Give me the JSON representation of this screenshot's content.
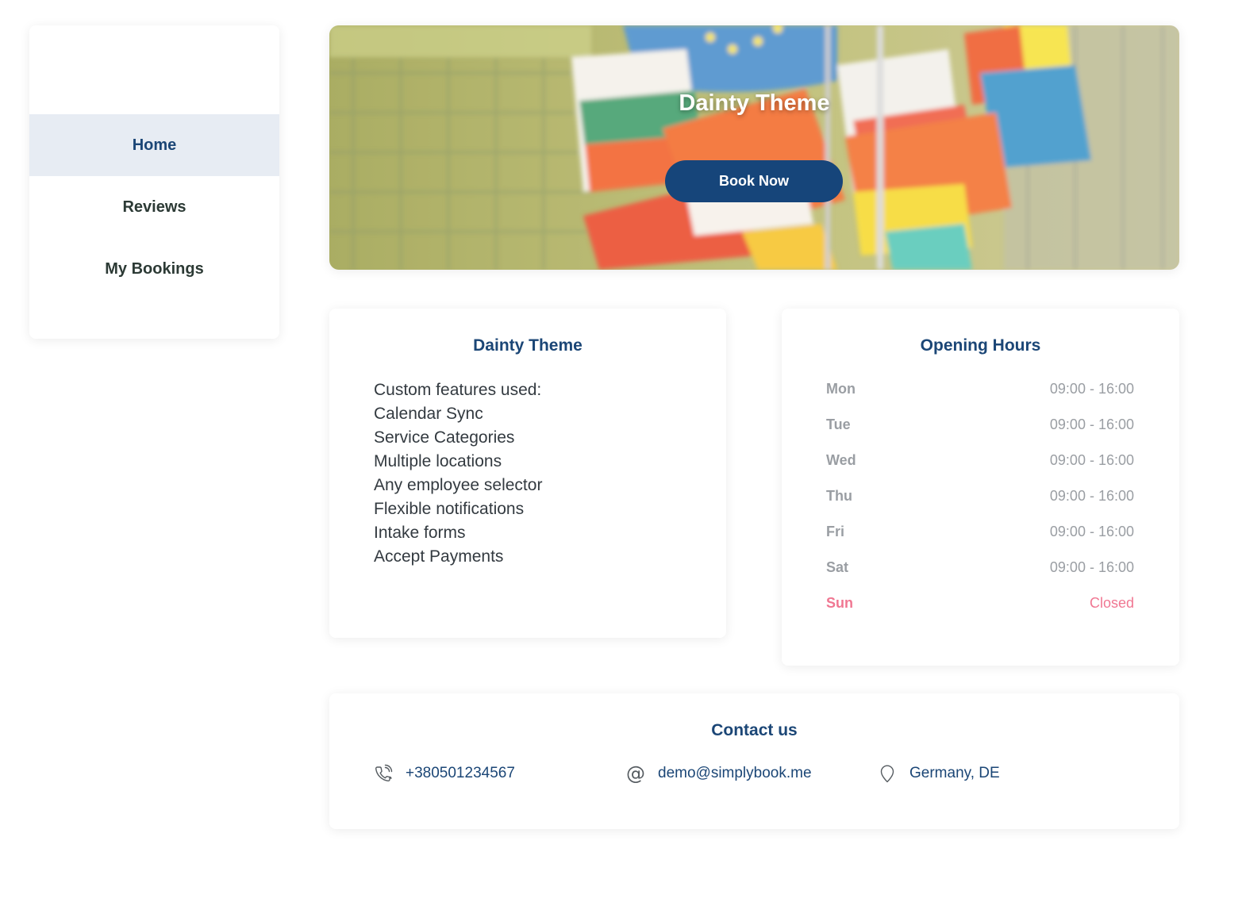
{
  "sidebar": {
    "items": [
      {
        "label": "Home",
        "active": true
      },
      {
        "label": "Reviews",
        "active": false
      },
      {
        "label": "My Bookings",
        "active": false
      }
    ]
  },
  "hero": {
    "title": "Dainty Theme",
    "button_label": "Book Now"
  },
  "about": {
    "title": "Dainty Theme",
    "body": "Custom features used:\nCalendar Sync\nService Categories\nMultiple locations\nAny employee selector\nFlexible notifications\nIntake forms\nAccept Payments"
  },
  "hours": {
    "title": "Opening Hours",
    "rows": [
      {
        "day": "Mon",
        "time": "09:00 - 16:00"
      },
      {
        "day": "Tue",
        "time": "09:00 - 16:00"
      },
      {
        "day": "Wed",
        "time": "09:00 - 16:00"
      },
      {
        "day": "Thu",
        "time": "09:00 - 16:00"
      },
      {
        "day": "Fri",
        "time": "09:00 - 16:00"
      },
      {
        "day": "Sat",
        "time": "09:00 - 16:00"
      },
      {
        "day": "Sun",
        "time": "Closed"
      }
    ]
  },
  "contact": {
    "title": "Contact us",
    "phone": "+380501234567",
    "email": "demo@simplybook.me",
    "location": "Germany, DE",
    "phone_icon": "phone-icon",
    "email_icon": "at-icon",
    "location_icon": "map-pin-icon"
  },
  "colors": {
    "primary": "#1b4676",
    "button": "#16457a",
    "active_nav_bg": "#e7ecf3",
    "closed": "#f07792",
    "muted": "#9a9ea3"
  }
}
